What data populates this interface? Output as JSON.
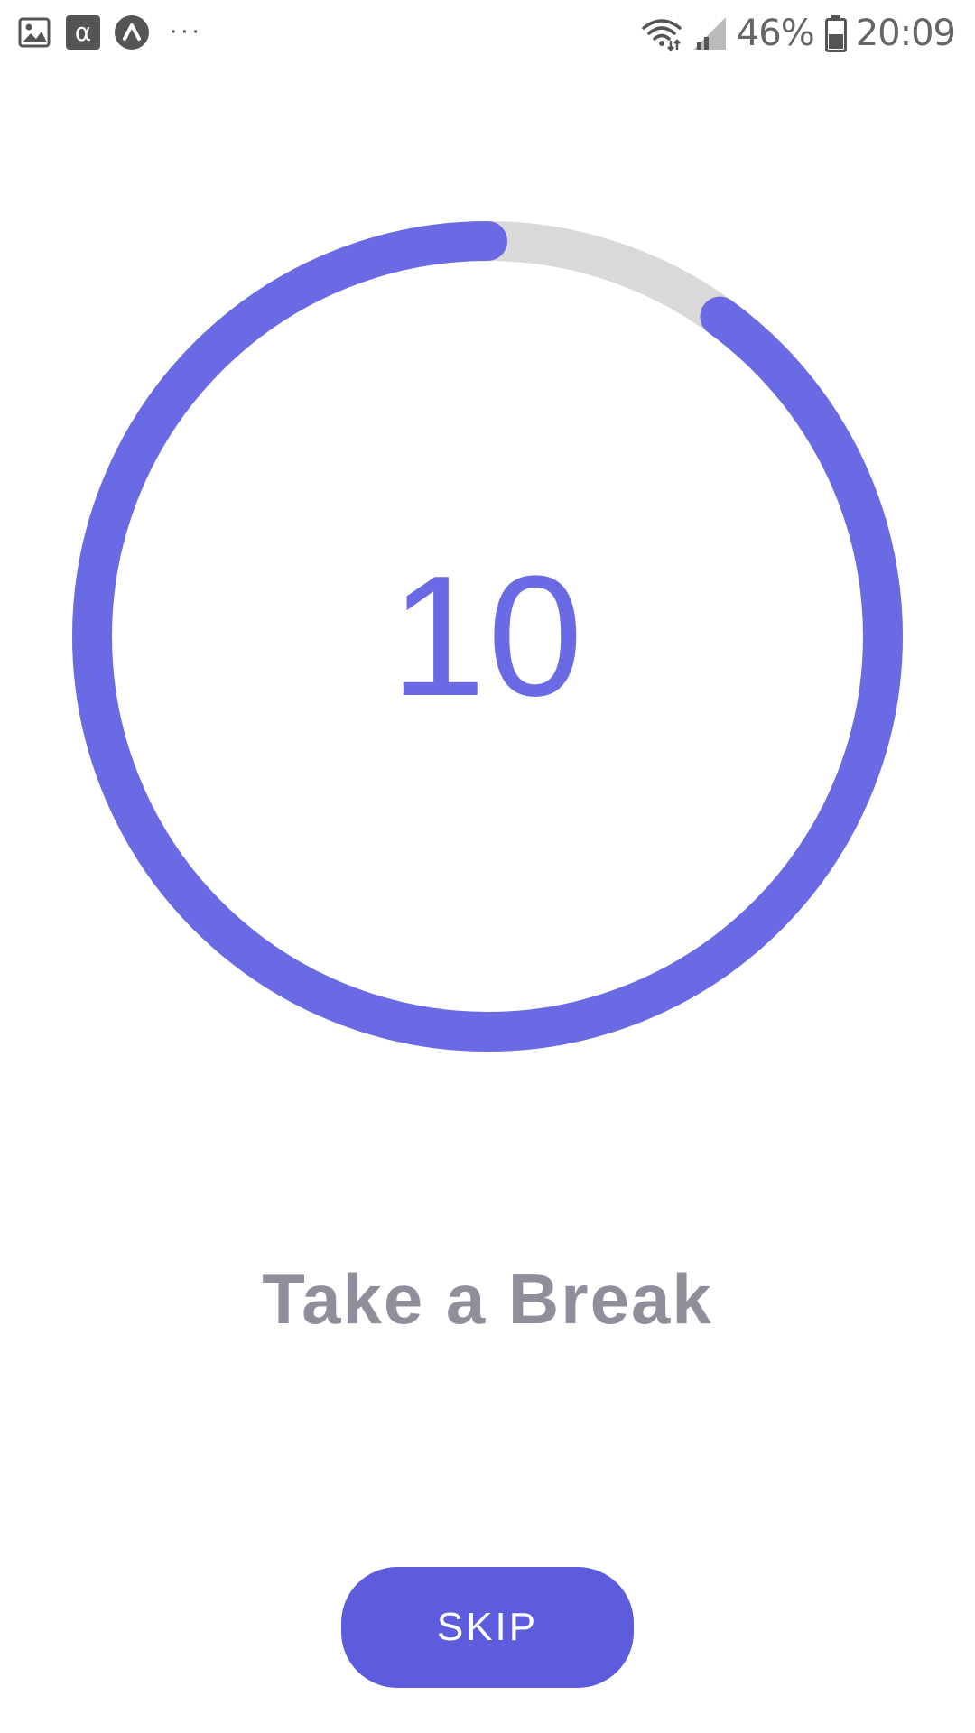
{
  "status_bar": {
    "notifications": [
      {
        "icon": "image-icon"
      },
      {
        "icon": "alpha-icon",
        "glyph": "α"
      },
      {
        "icon": "caret-up-circle-icon",
        "glyph": "^"
      }
    ],
    "more_indicator": "···",
    "wifi_icon": "wifi-icon",
    "signal_icon": "signal-icon",
    "battery_percent": "46%",
    "battery_icon": "battery-icon",
    "time": "20:09"
  },
  "timer": {
    "value": "10",
    "progress": 0.9,
    "ring_color": "#6a6be4",
    "track_color": "#d9d9d9"
  },
  "headline": "Take a Break",
  "skip_button": {
    "label": "SKIP",
    "color": "#5c5cdc"
  }
}
